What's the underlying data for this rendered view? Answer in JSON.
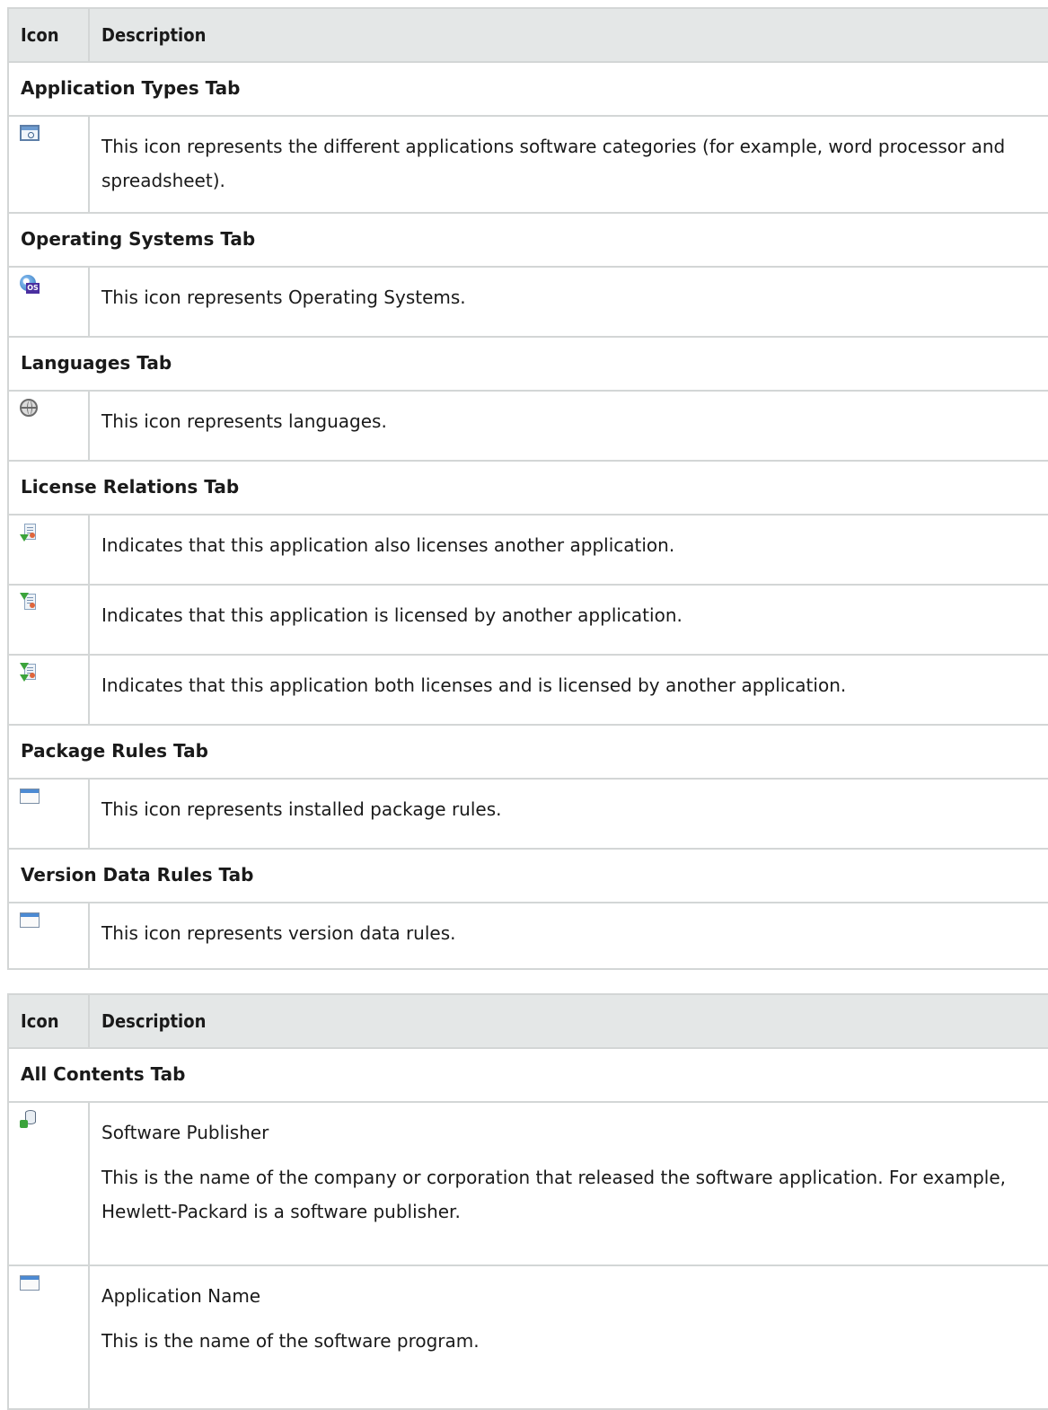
{
  "table1": {
    "header": {
      "icon": "Icon",
      "description": "Description"
    },
    "sections": [
      {
        "title": "Application Types Tab",
        "rows": [
          {
            "icon": "application-type-icon",
            "text": "This icon represents the different applications software categories (for example, word processor and spreadsheet)."
          }
        ]
      },
      {
        "title": "Operating Systems Tab",
        "rows": [
          {
            "icon": "operating-system-icon",
            "text": "This icon represents Operating Systems."
          }
        ]
      },
      {
        "title": "Languages Tab",
        "rows": [
          {
            "icon": "globe-icon",
            "text": "This icon represents languages."
          }
        ]
      },
      {
        "title": "License Relations Tab",
        "rows": [
          {
            "icon": "licenses-another-icon",
            "text": "Indicates that this application also licenses another application."
          },
          {
            "icon": "licensed-by-another-icon",
            "text": "Indicates that this application is licensed by another application."
          },
          {
            "icon": "licenses-both-icon",
            "text": "Indicates that this application both licenses and is licensed by another application."
          }
        ]
      },
      {
        "title": "Package Rules Tab",
        "rows": [
          {
            "icon": "window-icon",
            "text": "This icon represents installed package rules."
          }
        ]
      },
      {
        "title": "Version Data Rules Tab",
        "rows": [
          {
            "icon": "window-icon",
            "text": "This icon represents version data rules."
          }
        ]
      }
    ]
  },
  "table2": {
    "header": {
      "icon": "Icon",
      "description": "Description"
    },
    "section_title": "All Contents Tab",
    "rows": [
      {
        "icon": "software-publisher-icon",
        "title": "Software Publisher",
        "text": "This is the name of the company or corporation that released the software application. For example, Hewlett-Packard is a software publisher."
      },
      {
        "icon": "window-icon",
        "title": "Application Name",
        "text": "This is the name of the software program."
      }
    ]
  }
}
